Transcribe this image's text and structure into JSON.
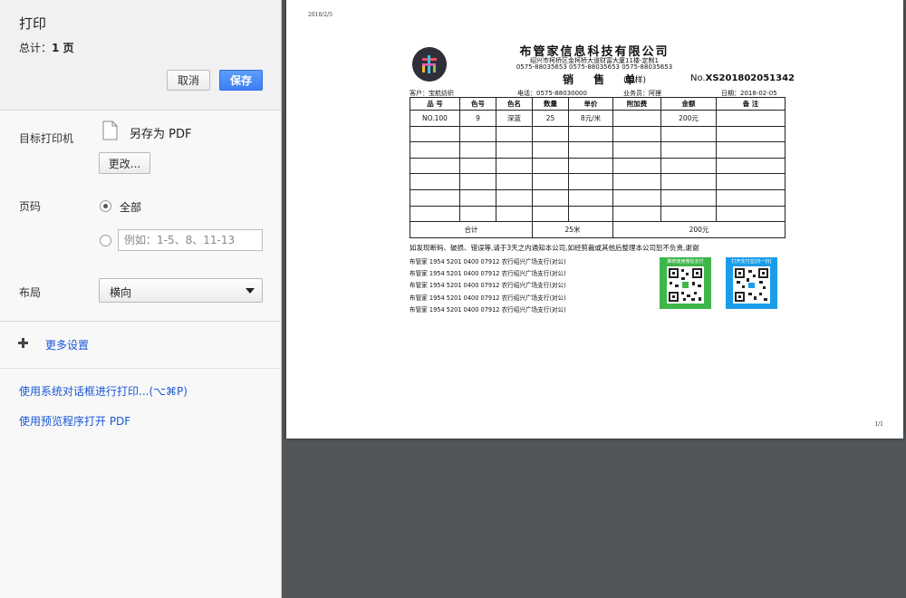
{
  "panel": {
    "title": "打印",
    "summary_label": "总计：",
    "summary_count": "1 页",
    "cancel_label": "取消",
    "save_label": "保存",
    "destination": {
      "label": "目标打印机",
      "value": "另存为 PDF",
      "change_label": "更改..."
    },
    "pages": {
      "label": "页码",
      "option_all": "全部",
      "range_placeholder": "例如：1-5、8、11-13"
    },
    "layout": {
      "label": "布局",
      "value": "横向"
    },
    "more_settings": "更多设置",
    "system_dialog_link": "使用系统对话框进行打印...(⌥⌘P)",
    "open_preview_link": "使用预览程序打开 PDF"
  },
  "document": {
    "print_date": "2018/2/5",
    "page_number": "1/1",
    "company": "布管家信息科技有限公司",
    "address": "绍兴市柯桥区金柯桥大道财富大厦11楼-定制1",
    "phones": "0575-88035653  0575-88035653  0575-88035653",
    "title": "销 售 单",
    "subtitle": "(剪样)",
    "number_prefix": "No.",
    "number": "XS201802051342",
    "customer": "客户：宝航纺织",
    "phone": "电话：0575-88030000",
    "salesman": "业务员：阿狸",
    "date": "日期：2018-02-05",
    "table": {
      "headers": [
        "品 号",
        "色号",
        "色名",
        "数量",
        "单价",
        "附加费",
        "金额",
        "备 注"
      ],
      "row1": [
        "NO.100",
        "9",
        "深蓝",
        "25",
        "8元/米",
        "",
        "200元",
        ""
      ],
      "total_label": "合计",
      "total_qty": "25米",
      "total_amount": "200元"
    },
    "note": "如发现断码、破损、错误等,请于3天之内通知本公司,如经剪裁或其他后整理本公司恕不负责,谢谢",
    "bank_lines": [
      "布管家   1954 5201 0400 07912   农行绍兴广场支行(对公)",
      "布管家   1954 5201 0400 07912   农行绍兴广场支行(对公)",
      "布管家   1954 5201 0400 07912   农行绍兴广场支行(对公)",
      "布管家   1954 5201 0400 07912   农行绍兴广场支行(对公)",
      "布管家   1954 5201 0400 07912   农行绍兴广场支行(对公)"
    ],
    "qr_wechat_caption": "推荐使用微信支付",
    "qr_alipay_caption": "打开支付宝[扫一扫]"
  },
  "colors": {
    "accent": "#3d7ef3",
    "link": "#1a56d6",
    "preview_bg": "#525659",
    "wechat_green": "#3eb64a",
    "alipay_blue": "#1a9de8"
  },
  "icons": {
    "destination": "document-icon",
    "more": "plus-icon",
    "dropdown": "chevron-down-icon"
  }
}
